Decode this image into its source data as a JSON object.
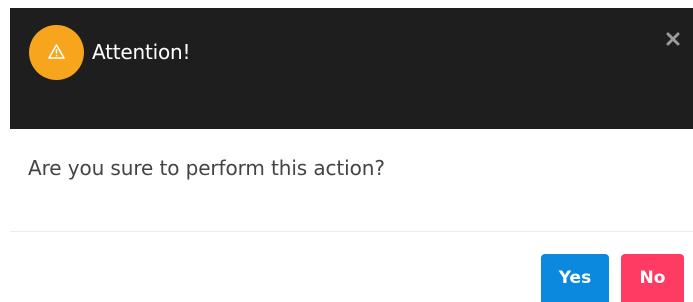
{
  "dialog": {
    "title": "Attention!",
    "message": "Are you sure to perform this action?",
    "header_color": "#1e1e1e",
    "warning_icon": "warning-triangle-icon",
    "warning_badge_color": "#f7a51c",
    "close_icon": "close-icon",
    "buttons": {
      "yes": {
        "label": "Yes",
        "color": "#0b89de"
      },
      "no": {
        "label": "No",
        "color": "#ff3b63"
      }
    }
  }
}
